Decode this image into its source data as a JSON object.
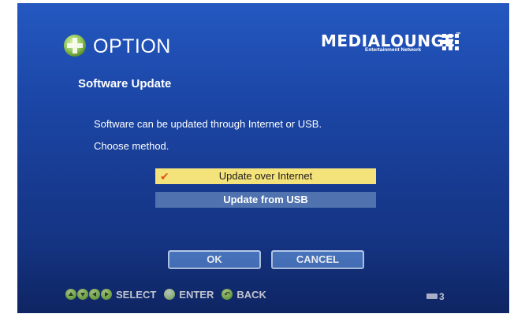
{
  "header": {
    "title": "OPTION",
    "icon": "dpad-option-icon",
    "brand": {
      "name": "MEDIALOUNGE",
      "tagline": "Entertainment Network"
    }
  },
  "section": {
    "title": "Software Update",
    "line1": "Software can be updated through Internet or USB.",
    "line2": "Choose method."
  },
  "methods": [
    {
      "label": "Update over Internet",
      "selected": true
    },
    {
      "label": "Update from USB",
      "selected": false
    }
  ],
  "buttons": {
    "ok": "OK",
    "cancel": "CANCEL"
  },
  "footer": {
    "select_label": "SELECT",
    "enter_label": "ENTER",
    "back_label": "BACK",
    "page_number": "3"
  },
  "colors": {
    "background_top": "#2458c0",
    "background_bottom": "#112c73",
    "selected_item": "#f4e27a",
    "normal_item": "#5072ae",
    "check_mark": "#e0521a",
    "button_fill": "#4a78c2",
    "nav_key_green": "#9bd64a"
  }
}
